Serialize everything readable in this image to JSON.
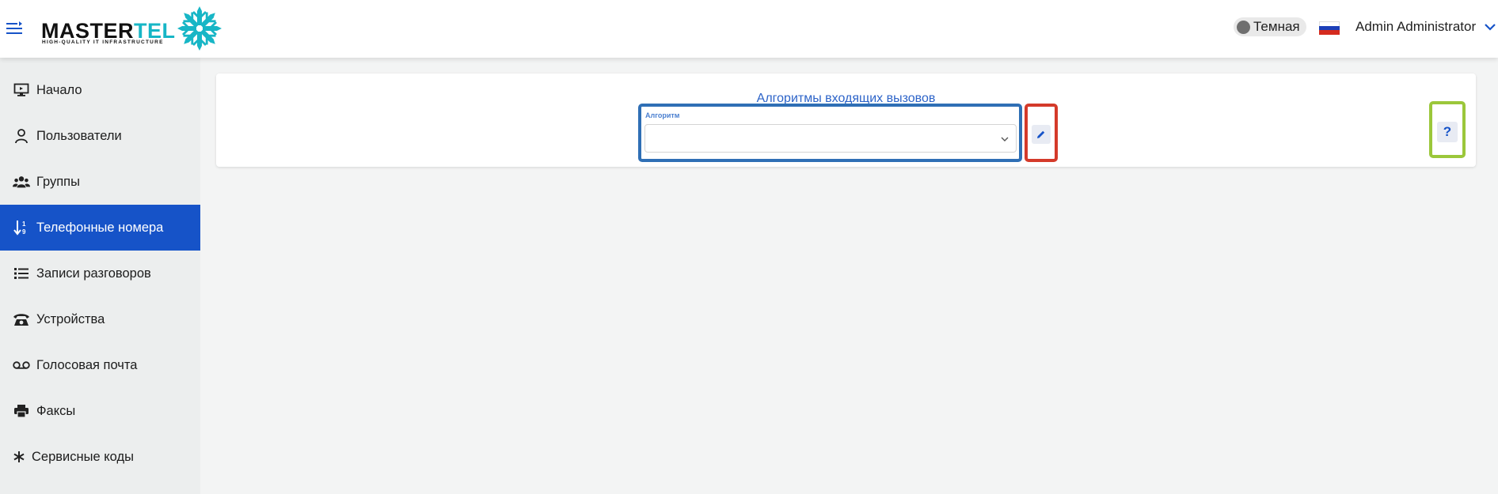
{
  "header": {
    "logo": {
      "brand_part1": "MASTER",
      "brand_part2": "TEL",
      "tagline": "HIGH-QUALITY IT INFRASTRUCTURE"
    },
    "theme_toggle_label": "Темная",
    "language_flag": "flag-ru-icon",
    "user_name": "Admin Administrator"
  },
  "sidebar": {
    "items": [
      {
        "label": "Начало",
        "icon": "monitor-icon",
        "active": false
      },
      {
        "label": "Пользователи",
        "icon": "user-icon",
        "active": false
      },
      {
        "label": "Группы",
        "icon": "users-group-icon",
        "active": false
      },
      {
        "label": "Телефонные номера",
        "icon": "sort-numbers-icon",
        "active": true
      },
      {
        "label": "Записи разговоров",
        "icon": "list-icon",
        "active": false
      },
      {
        "label": "Устройства",
        "icon": "phone-icon",
        "active": false
      },
      {
        "label": "Голосовая почта",
        "icon": "voicemail-icon",
        "active": false
      },
      {
        "label": "Факсы",
        "icon": "printer-icon",
        "active": false
      },
      {
        "label": "Сервисные коды",
        "icon": "asterisk-icon",
        "active": false
      }
    ]
  },
  "main": {
    "card_title": "Алгоритмы входящих вызовов",
    "select": {
      "label": "Алгоритм",
      "value": ""
    },
    "help_label": "?"
  },
  "colors": {
    "accent": "#1653c8",
    "brand_teal": "#17b6c6",
    "highlight_blue": "#2f6fb5",
    "highlight_red": "#d43a2a",
    "highlight_green": "#9bc73a"
  }
}
